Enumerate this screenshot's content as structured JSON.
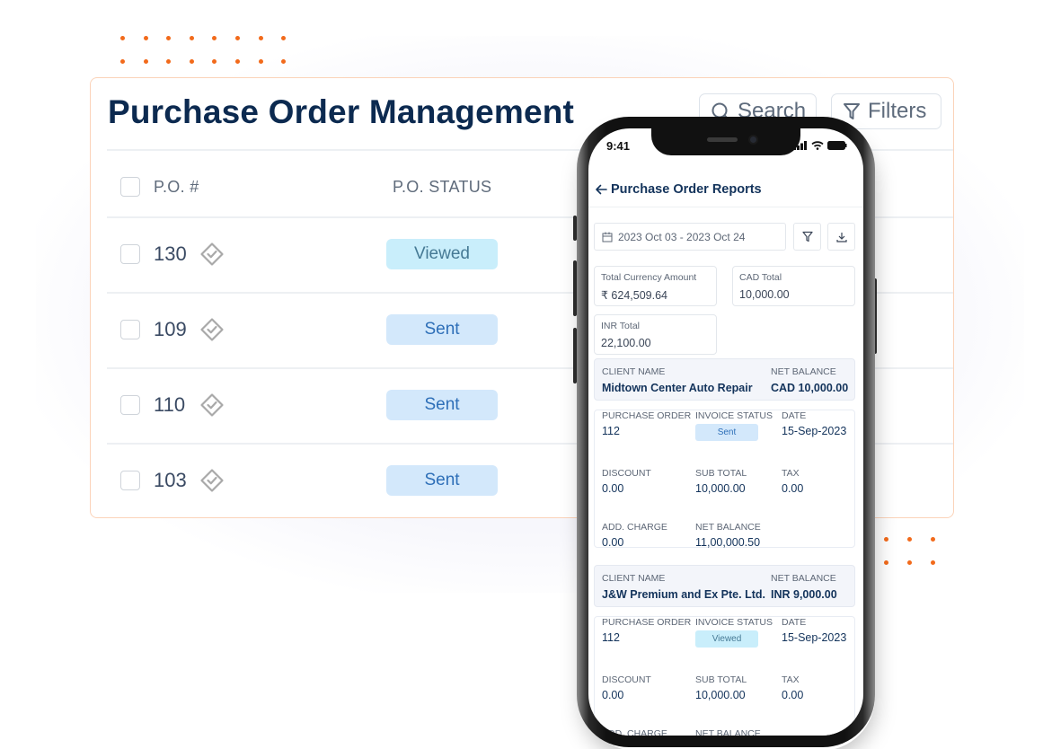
{
  "desktop": {
    "title": "Purchase Order Management",
    "search_label": "Search",
    "filters_label": "Filters",
    "columns": [
      "P.O. #",
      "P.O. STATUS"
    ],
    "rows": [
      {
        "po": "130",
        "status": "Viewed",
        "status_type": "viewed"
      },
      {
        "po": "109",
        "status": "Sent",
        "status_type": "sent"
      },
      {
        "po": "110",
        "status": "Sent",
        "status_type": "sent"
      },
      {
        "po": "103",
        "status": "Sent",
        "status_type": "sent"
      }
    ]
  },
  "mobile": {
    "status_time": "9:41",
    "header_title": "Purchase Order Reports",
    "date_range": "2023 Oct 03 - 2023 Oct 24",
    "stats": [
      {
        "label": "Total Currency Amount",
        "value": "₹ 624,509.64"
      },
      {
        "label": "CAD Total",
        "value": "10,000.00"
      },
      {
        "label": "INR Total",
        "value": "22,100.00"
      }
    ],
    "clients": [
      {
        "client_label": "CLIENT NAME",
        "client_name": "Midtown Center Auto Repair",
        "balance_label": "NET BALANCE",
        "balance": "CAD 10,000.00",
        "details": {
          "purchase_order_label": "PURCHASE ORDER",
          "purchase_order": "112",
          "invoice_status_label": "INVOICE STATUS",
          "invoice_status": "Sent",
          "date_label": "DATE",
          "date": "15-Sep-2023",
          "discount_label": "DISCOUNT",
          "discount": "0.00",
          "sub_total_label": "SUB TOTAL",
          "sub_total": "10,000.00",
          "tax_label": "TAX",
          "tax": "0.00",
          "add_charge_label": "ADD. CHARGE",
          "add_charge": "0.00",
          "net_balance_label": "NET BALANCE",
          "net_balance": "11,00,000.50"
        }
      },
      {
        "client_label": "CLIENT NAME",
        "client_name": "J&W Premium and Ex Pte. Ltd.",
        "balance_label": "NET BALANCE",
        "balance": "INR 9,000.00",
        "details": {
          "purchase_order_label": "PURCHASE ORDER",
          "purchase_order": "112",
          "invoice_status_label": "INVOICE STATUS",
          "invoice_status": "Viewed",
          "date_label": "DATE",
          "date": "15-Sep-2023",
          "discount_label": "DISCOUNT",
          "discount": "0.00",
          "sub_total_label": "SUB TOTAL",
          "sub_total": "10,000.00",
          "tax_label": "TAX",
          "tax": "0.00",
          "add_charge_label": "ADD. CHARGE",
          "add_charge": "",
          "net_balance_label": "NET BALANCE",
          "net_balance": ""
        }
      }
    ]
  },
  "colors": {
    "accent_orange": "#f26a1b",
    "title_navy": "#0c2a50",
    "sent_bg": "#d3e8fb",
    "viewed_bg": "#c9eefb"
  }
}
